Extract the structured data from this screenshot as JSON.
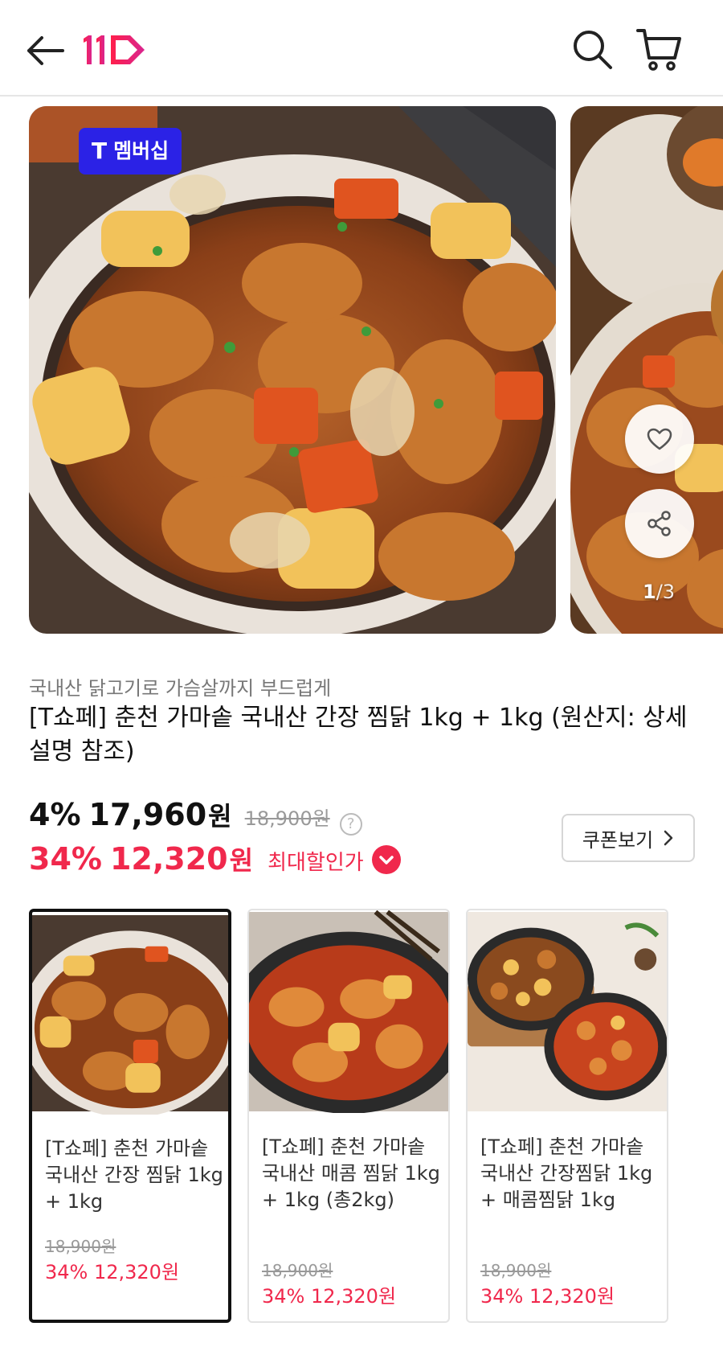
{
  "header": {
    "logo_text": "11",
    "brand_color": "#f0284c"
  },
  "carousel": {
    "badge_t": "T",
    "badge_text": "멤버십",
    "counter_current": "1",
    "counter_sep": "/",
    "counter_total": "3"
  },
  "product": {
    "subtitle": "국내산 닭고기로 가슴살까지 부드럽게",
    "title": "[T쇼페] 춘천 가마솥 국내산 간장 찜닭 1kg + 1kg (원산지: 상세설명 참조)",
    "price_rate": "4%",
    "price": "17,960",
    "price_unit": "원",
    "original_price": "18,900원",
    "help": "?",
    "max_rate": "34%",
    "max_price": "12,320",
    "max_unit": "원",
    "max_label": "최대할인가",
    "coupon_label": "쿠폰보기"
  },
  "options": [
    {
      "title": "[T쇼페] 춘천 가마솥 국내산 간장 찜닭 1kg + 1kg",
      "original_price": "18,900원",
      "price": "34% 12,320원",
      "selected": true
    },
    {
      "title": "[T쇼페] 춘천 가마솥 국내산 매콤 찜닭 1kg + 1kg (총2kg)",
      "original_price": "18,900원",
      "price": "34% 12,320원",
      "selected": false
    },
    {
      "title": "[T쇼페] 춘천 가마솥 국내산 간장찜닭 1kg + 매콤찜닭 1kg",
      "original_price": "18,900원",
      "price": "34% 12,320원",
      "selected": false
    }
  ],
  "colors": {
    "accent": "#f0284c",
    "tmember": "#2b22e6"
  },
  "icons": [
    "back-arrow-icon",
    "search-icon",
    "cart-icon",
    "heart-icon",
    "share-icon",
    "chevron-right-icon",
    "chevron-down-icon",
    "help-icon"
  ]
}
